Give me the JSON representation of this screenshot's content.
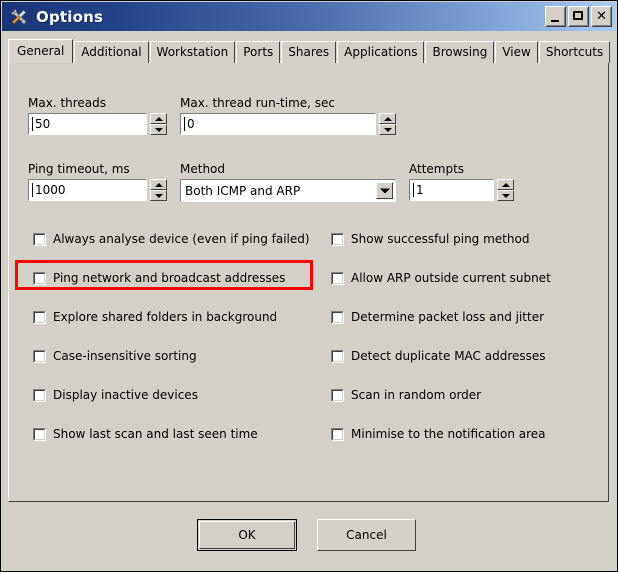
{
  "window": {
    "title": "Options",
    "icon": "tools-icon",
    "controls": [
      {
        "name": "minimize",
        "label": "_"
      },
      {
        "name": "maximize",
        "label": "□"
      },
      {
        "name": "close",
        "label": "✕"
      }
    ]
  },
  "tabs": [
    {
      "label": "General",
      "active": true
    },
    {
      "label": "Additional",
      "active": false
    },
    {
      "label": "Workstation",
      "active": false
    },
    {
      "label": "Ports",
      "active": false
    },
    {
      "label": "Shares",
      "active": false
    },
    {
      "label": "Applications",
      "active": false
    },
    {
      "label": "Browsing",
      "active": false
    },
    {
      "label": "View",
      "active": false
    },
    {
      "label": "Shortcuts",
      "active": false
    }
  ],
  "fields": {
    "max_threads": {
      "label": "Max. threads",
      "value": "50"
    },
    "max_thread_runtime": {
      "label": "Max. thread run-time, sec",
      "value": "0"
    },
    "ping_timeout": {
      "label": "Ping timeout, ms",
      "value": "1000"
    },
    "method": {
      "label": "Method",
      "value": "Both ICMP and ARP"
    },
    "attempts": {
      "label": "Attempts",
      "value": "1"
    }
  },
  "checkboxes_left": [
    {
      "label": "Always analyse device (even if ping failed)",
      "checked": false
    },
    {
      "label": "Ping network and broadcast addresses",
      "checked": false
    },
    {
      "label": "Explore shared folders in background",
      "checked": false
    },
    {
      "label": "Case-insensitive sorting",
      "checked": false
    },
    {
      "label": "Display inactive devices",
      "checked": false
    },
    {
      "label": "Show last scan and last seen time",
      "checked": false
    }
  ],
  "checkboxes_right": [
    {
      "label": "Show successful ping method",
      "checked": false
    },
    {
      "label": "Allow ARP outside current subnet",
      "checked": false
    },
    {
      "label": "Determine packet loss and jitter",
      "checked": false
    },
    {
      "label": "Detect duplicate MAC addresses",
      "checked": false
    },
    {
      "label": "Scan in random order",
      "checked": false
    },
    {
      "label": "Minimise to the notification area",
      "checked": false
    }
  ],
  "buttons": {
    "ok": "OK",
    "cancel": "Cancel"
  },
  "annotation": {
    "color": "#ff0000",
    "target": "Ping network and broadcast addresses"
  }
}
